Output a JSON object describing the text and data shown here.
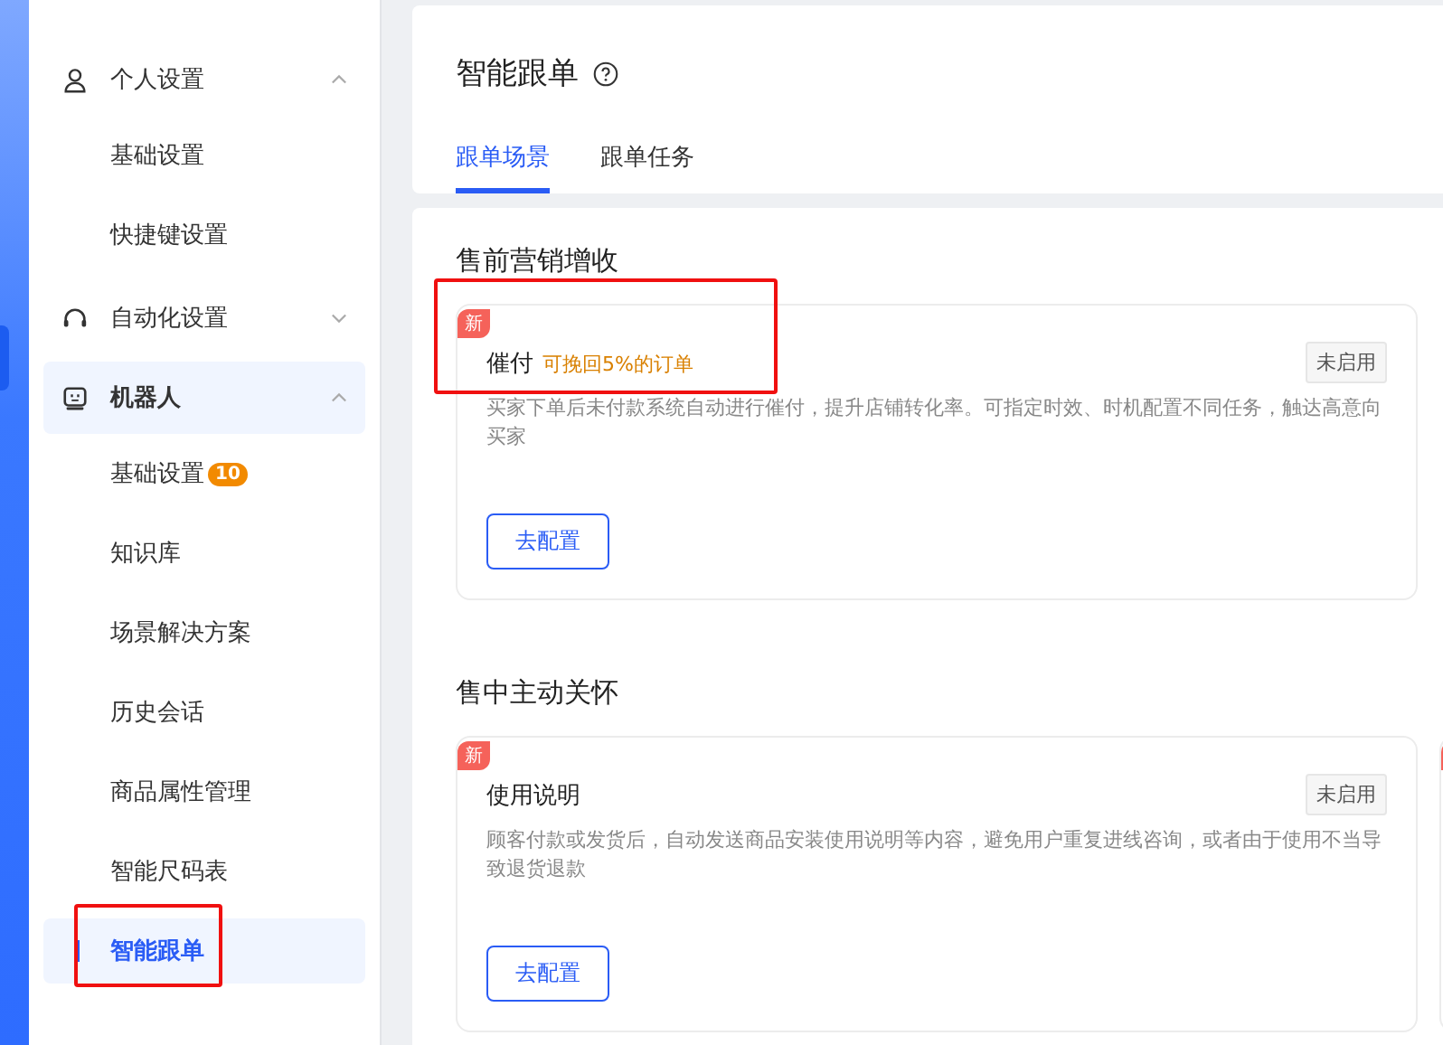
{
  "sidebar": {
    "groups": [
      {
        "label": "个人设置",
        "expanded": true,
        "selected": false,
        "items": [
          {
            "label": "基础设置",
            "selected": false,
            "annotated": false
          },
          {
            "label": "快捷键设置",
            "selected": false,
            "annotated": false
          }
        ]
      },
      {
        "label": "自动化设置",
        "expanded": false,
        "selected": false
      },
      {
        "label": "机器人",
        "expanded": true,
        "selected": true,
        "items": [
          {
            "label": "基础设置",
            "badge": "10",
            "selected": false,
            "annotated": false
          },
          {
            "label": "知识库",
            "selected": false,
            "annotated": false
          },
          {
            "label": "场景解决方案",
            "selected": false,
            "annotated": false
          },
          {
            "label": "历史会话",
            "selected": false,
            "annotated": false
          },
          {
            "label": "商品属性管理",
            "selected": false,
            "annotated": false
          },
          {
            "label": "智能尺码表",
            "selected": false,
            "annotated": false
          },
          {
            "label": "智能跟单",
            "selected": true,
            "annotated": true
          }
        ]
      }
    ]
  },
  "header": {
    "title": "智能跟单",
    "tabs": [
      {
        "label": "跟单场景",
        "selected": true
      },
      {
        "label": "跟单任务",
        "selected": false
      }
    ]
  },
  "sections": [
    {
      "title": "售前营销增收",
      "cards": [
        {
          "badge": "新",
          "title": "催付",
          "highlight": "可挽回5%的订单",
          "status": "未启用",
          "description": "买家下单后未付款系统自动进行催付，提升店铺转化率。可指定时效、时机配置不同任务，触达高意向买家",
          "button": "去配置",
          "annotated": true
        }
      ]
    },
    {
      "title": "售中主动关怀",
      "cards": [
        {
          "badge": "新",
          "title": "使用说明",
          "status": "未启用",
          "description": "顾客付款或发货后，自动发送商品安装使用说明等内容，避免用户重复进线咨询，或者由于使用不当导致退货退款",
          "button": "去配置",
          "annotated": false
        }
      ]
    }
  ]
}
